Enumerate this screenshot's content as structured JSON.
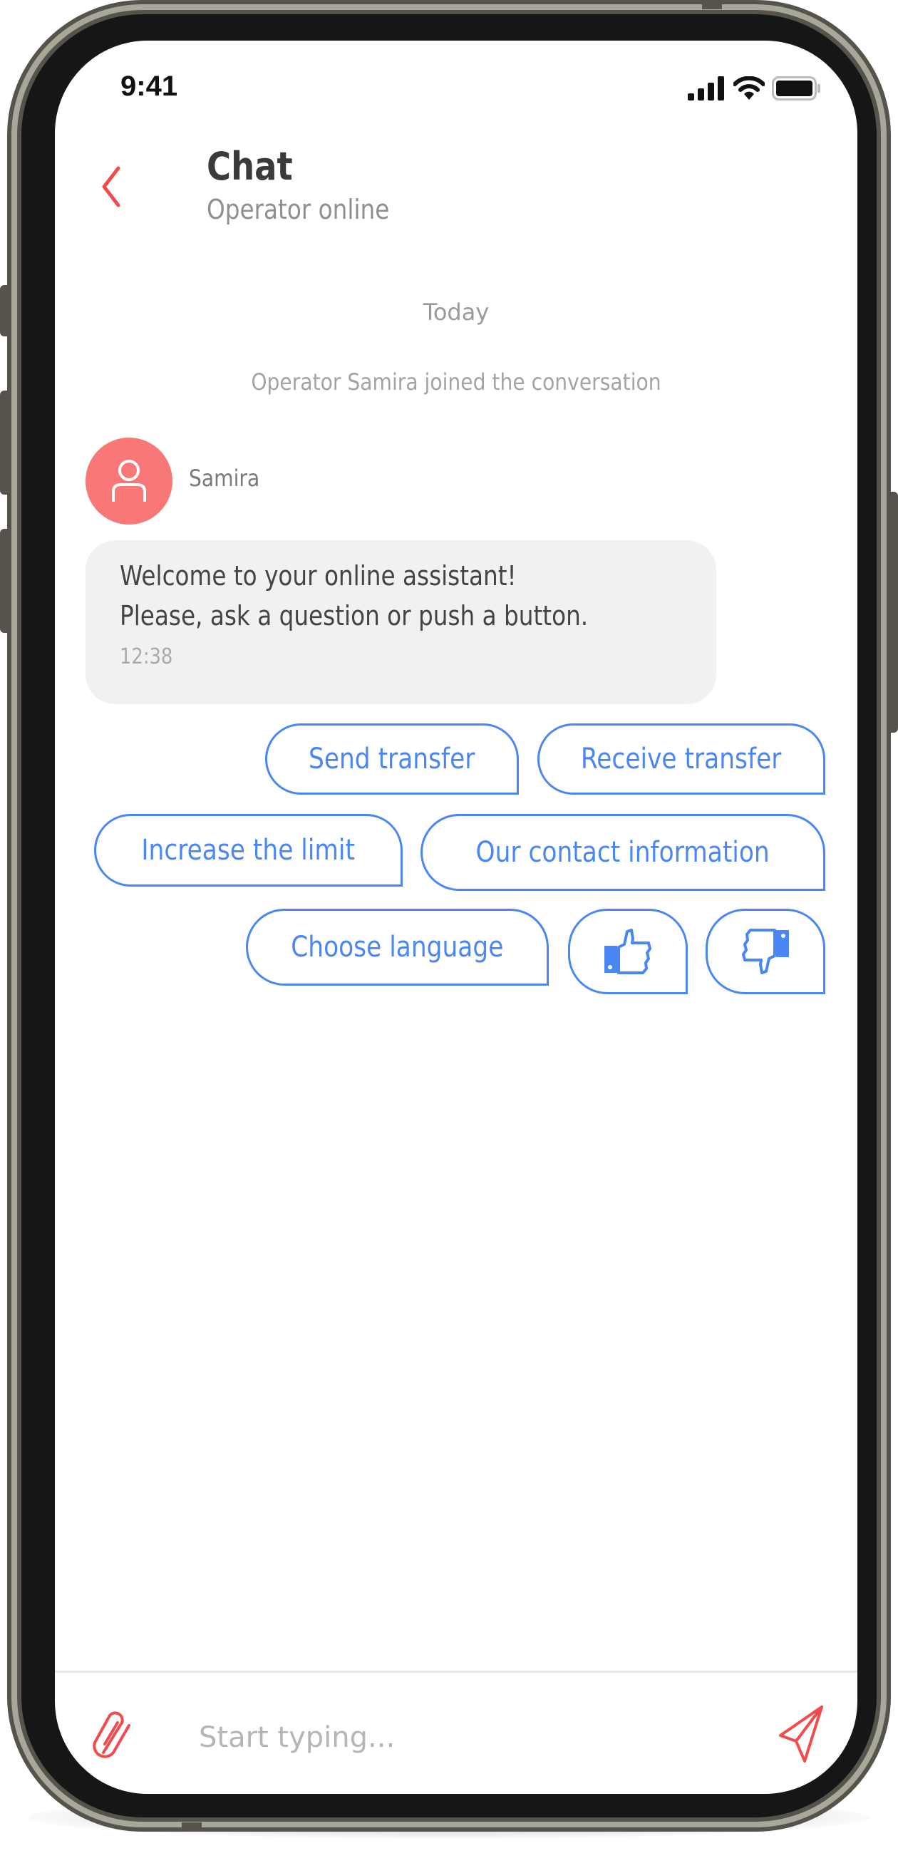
{
  "status_bar": {
    "time": "9:41",
    "icons": [
      "cellular-signal-icon",
      "wifi-icon",
      "battery-icon"
    ]
  },
  "header": {
    "back_icon": "chevron-left-icon",
    "title": "Chat",
    "subtitle": "Operator online"
  },
  "conversation": {
    "date_separator": "Today",
    "system_message": "Operator Samira joined the conversation",
    "messages": [
      {
        "sender": "Samira",
        "avatar_icon": "user-icon",
        "lines": [
          "Welcome to your online assistant!",
          "Please, ask a question or push a button."
        ],
        "time": "12:38"
      }
    ],
    "quick_replies": [
      {
        "label": "Send transfer"
      },
      {
        "label": "Receive transfer"
      },
      {
        "label": "Increase the limit"
      },
      {
        "label": "Our contact information"
      },
      {
        "label": "Choose language"
      },
      {
        "label": "",
        "icon": "thumbs-up-icon"
      },
      {
        "label": "",
        "icon": "thumbs-down-icon"
      }
    ]
  },
  "composer": {
    "attach_icon": "paperclip-icon",
    "placeholder": "Start typing...",
    "value": "",
    "send_icon": "send-icon"
  },
  "colors": {
    "accent_red": "#F24B4B",
    "avatar_bg": "#F87878",
    "quick_reply_blue": "#4A86F4",
    "bubble_bg": "#F1F1F1"
  }
}
